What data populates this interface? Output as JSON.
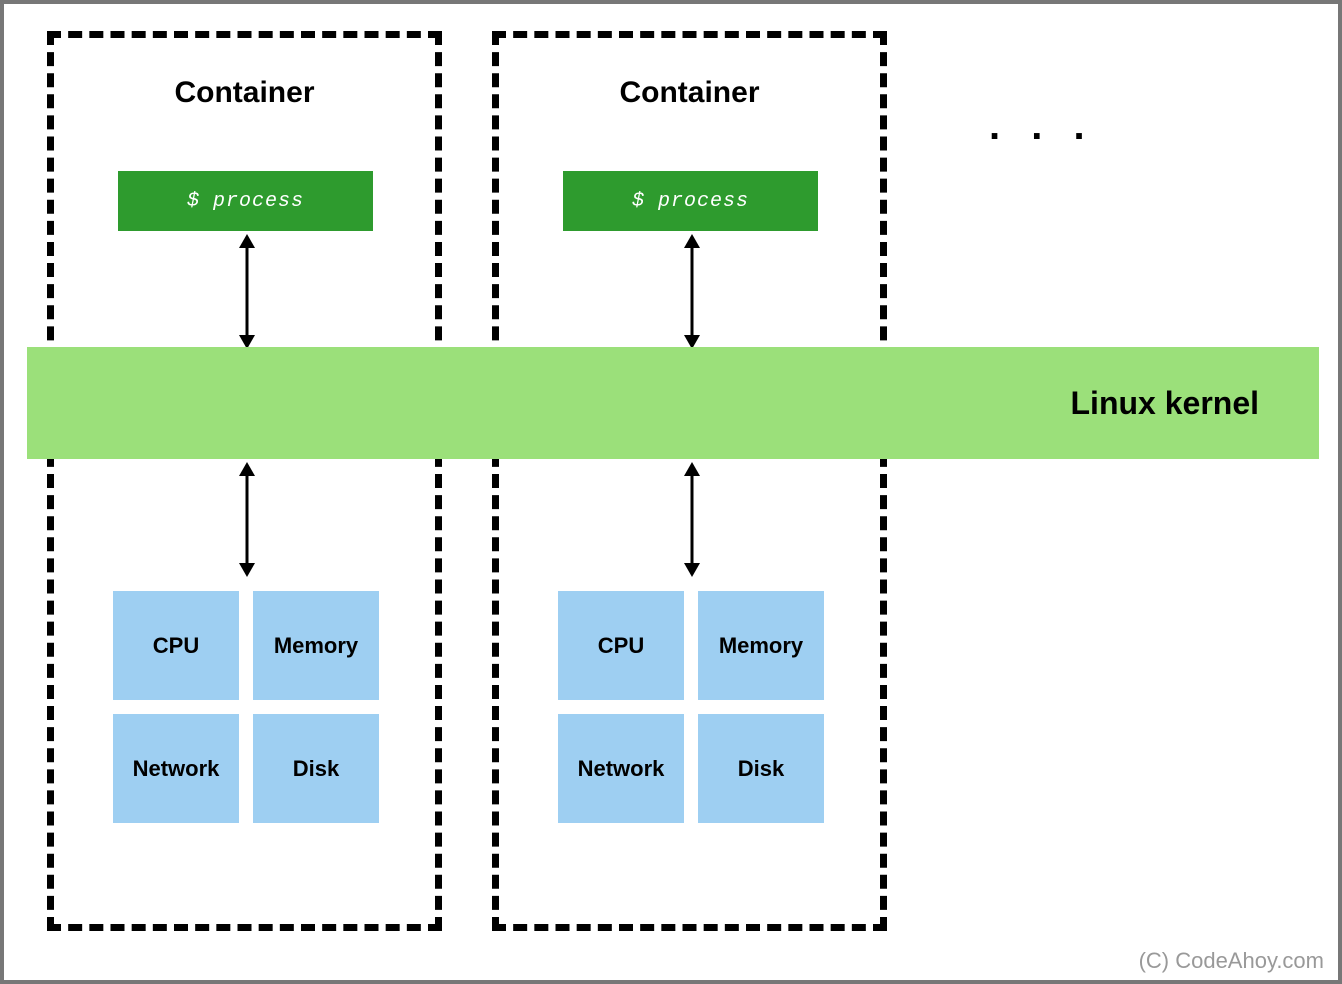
{
  "containers": [
    {
      "title": "Container",
      "process_label": "$ process",
      "resources": [
        "CPU",
        "Memory",
        "Network",
        "Disk"
      ]
    },
    {
      "title": "Container",
      "process_label": "$ process",
      "resources": [
        "CPU",
        "Memory",
        "Network",
        "Disk"
      ]
    }
  ],
  "kernel_label": "Linux kernel",
  "ellipsis": ". . .",
  "attribution": "(C) CodeAhoy.com",
  "colors": {
    "process_bg": "#2e9b2e",
    "process_text": "#ffffff",
    "kernel_bg": "#9be07a",
    "resource_bg": "#9ecff2",
    "border_dashed": "#000000",
    "outer_border": "#777777"
  }
}
